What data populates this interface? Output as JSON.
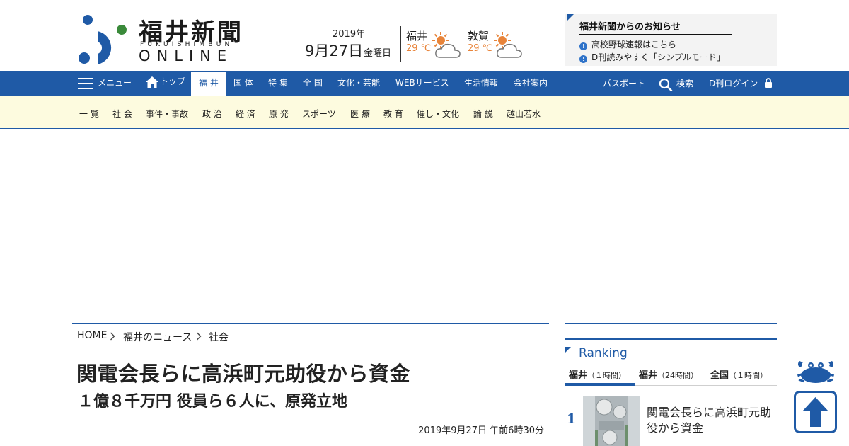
{
  "header": {
    "logo_jp": "福井新聞",
    "logo_sub": "FUKUISHIMBUN",
    "logo_online": "ONLINE",
    "brand_colors": {
      "primary": "#1f5aa6",
      "logo_blue": "#1f5aa6",
      "logo_green": "#3a8a3a",
      "accent": "#e8843a"
    }
  },
  "date": {
    "year": "2019年",
    "month_day": "9月27日",
    "weekday": "金曜日"
  },
  "weather": [
    {
      "city": "福井",
      "temp": "29 ℃",
      "icon": "sun-cloud-icon"
    },
    {
      "city": "敦賀",
      "temp": "29 ℃",
      "icon": "sun-cloud-icon"
    }
  ],
  "notice": {
    "title": "福井新聞からのお知らせ",
    "items": [
      "高校野球速報はこちら",
      "D刊読みやすく「シンプルモード」"
    ]
  },
  "nav": {
    "menu_label": "メニュー",
    "top_label": "トップ",
    "items": [
      "福 井",
      "国 体",
      "特 集",
      "全 国",
      "文化・芸能",
      "WEBサービス",
      "生活情報",
      "会社案内"
    ],
    "active": "福 井",
    "passport": "パスポート",
    "search": "検索",
    "login": "D刊ログイン"
  },
  "subnav": {
    "items": [
      "一 覧",
      "社 会",
      "事件・事故",
      "政 治",
      "経 済",
      "原 発",
      "スポーツ",
      "医 療",
      "教 育",
      "催し・文化",
      "論 説",
      "越山若水"
    ]
  },
  "breadcrumb": [
    "HOME",
    "福井のニュース",
    "社会"
  ],
  "article": {
    "headline": "関電会長らに高浜町元助役から資金",
    "subheadline": "１億８千万円 役員ら６人に、原発立地",
    "timestamp": "2019年9月27日 午前6時30分"
  },
  "ranking": {
    "title": "Ranking",
    "tabs": [
      {
        "name": "福井",
        "period": "（１時間）"
      },
      {
        "name": "福井",
        "period": "（24時間）"
      },
      {
        "name": "全国",
        "period": "（１時間）"
      }
    ],
    "active_tab": 0,
    "items": [
      {
        "rank": "1",
        "title": "関電会長らに高浜町元助役から資金"
      }
    ]
  }
}
